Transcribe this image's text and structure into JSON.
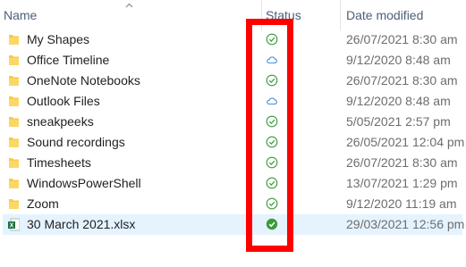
{
  "columns": {
    "name": "Name",
    "status": "Status",
    "date_modified": "Date modified"
  },
  "files": [
    {
      "name": "My Shapes",
      "type": "folder",
      "status": "synced",
      "date": "26/07/2021 8:30 am"
    },
    {
      "name": "Office Timeline",
      "type": "folder",
      "status": "cloud",
      "date": "9/12/2020 8:48 am"
    },
    {
      "name": "OneNote Notebooks",
      "type": "folder",
      "status": "synced",
      "date": "26/07/2021 8:30 am"
    },
    {
      "name": "Outlook Files",
      "type": "folder",
      "status": "cloud",
      "date": "9/12/2020 8:48 am"
    },
    {
      "name": "sneakpeeks",
      "type": "folder",
      "status": "synced",
      "date": "5/05/2021 2:57 pm"
    },
    {
      "name": "Sound recordings",
      "type": "folder",
      "status": "synced",
      "date": "26/05/2021 12:04 pm"
    },
    {
      "name": "Timesheets",
      "type": "folder",
      "status": "synced",
      "date": "26/07/2021 8:30 am"
    },
    {
      "name": "WindowsPowerShell",
      "type": "folder",
      "status": "synced",
      "date": "13/07/2021 1:29 pm"
    },
    {
      "name": "Zoom",
      "type": "folder",
      "status": "synced",
      "date": "9/12/2020 11:19 am"
    },
    {
      "name": "30 March 2021.xlsx",
      "type": "excel",
      "status": "always-available",
      "date": "29/03/2021 12:56 pm",
      "selected": true
    }
  ],
  "icons": {
    "folder": "folder-icon",
    "excel": "excel-file-icon",
    "synced": "synced-check-icon",
    "cloud": "cloud-only-icon",
    "always-available": "always-available-check-icon"
  },
  "colors": {
    "folder": "#f8c94a",
    "status_green": "#3a9b3a",
    "status_cloud": "#4a90d9",
    "selection": "#e5f3ff",
    "highlight": "#ff0000",
    "excel": "#1d6f42"
  }
}
